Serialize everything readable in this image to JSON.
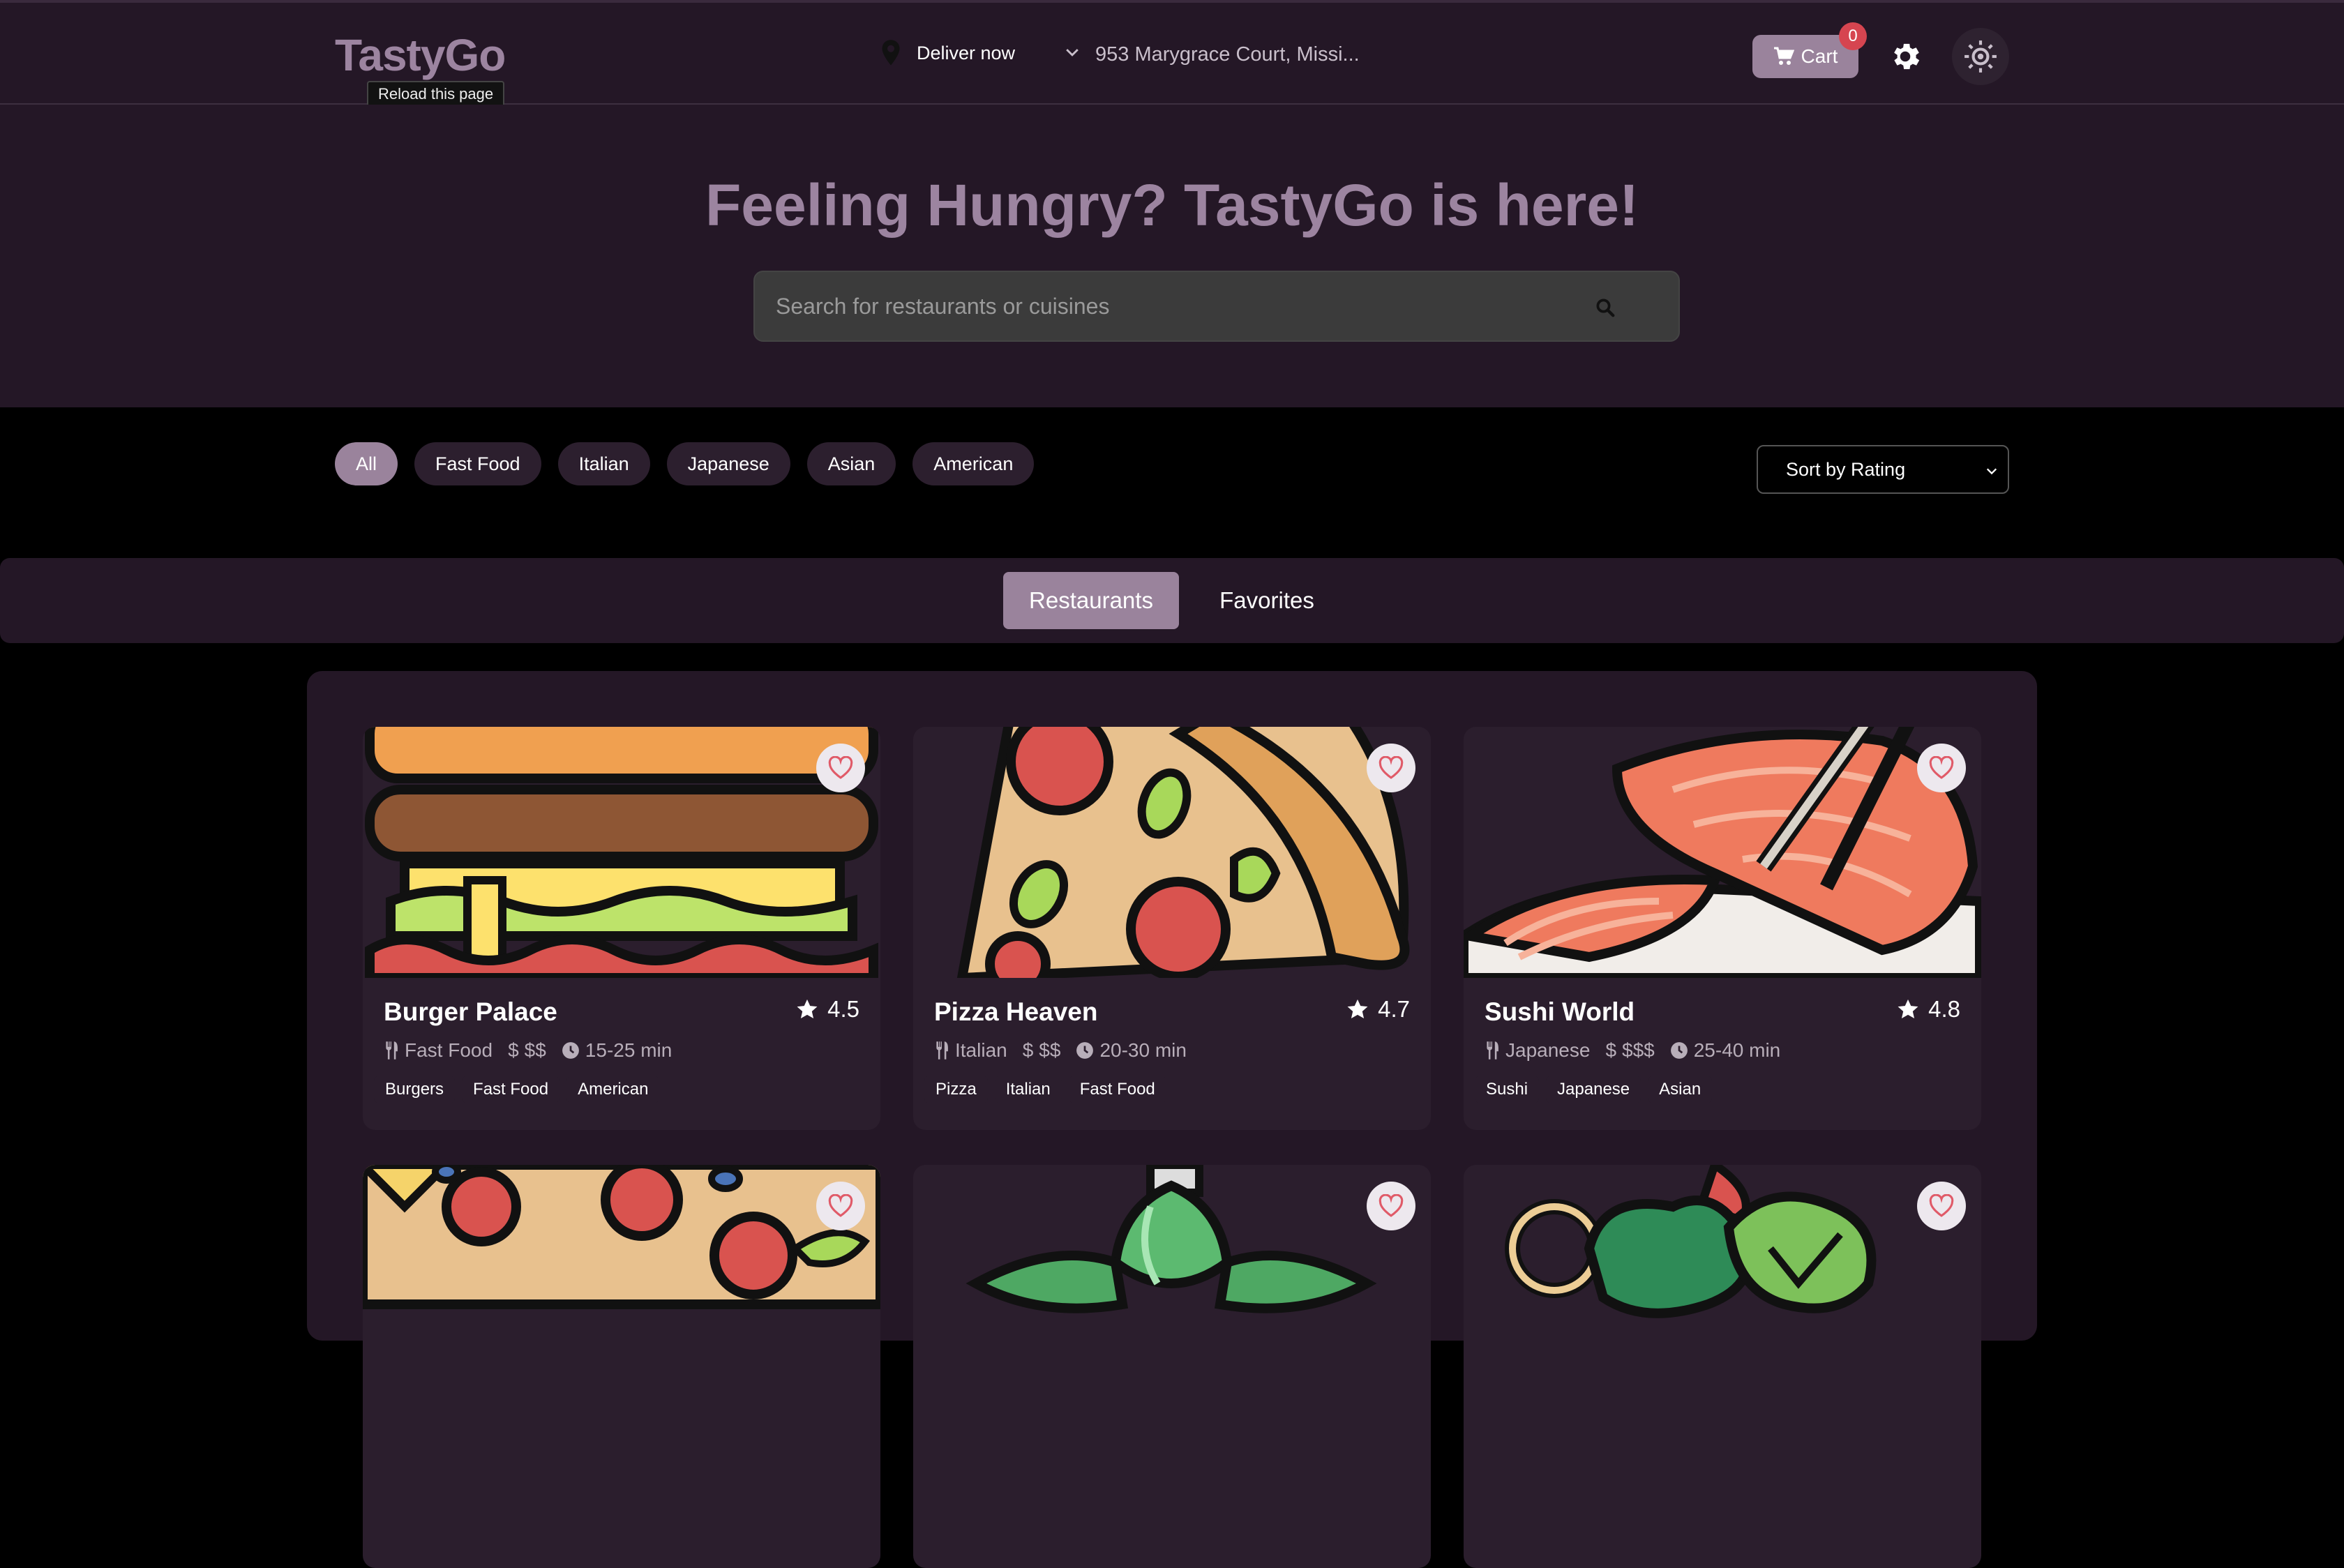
{
  "header": {
    "logo": "TastyGo",
    "tooltip": "Reload this page",
    "deliver_label": "Deliver now",
    "address": "953 Marygrace Court, Missi...",
    "cart_label": "Cart",
    "cart_count": "0",
    "icons": [
      "map-pin-icon",
      "chevron-down-icon",
      "cart-icon",
      "gear-icon",
      "sun-icon"
    ]
  },
  "hero": {
    "title": "Feeling Hungry? TastyGo is here!",
    "search_placeholder": "Search for restaurants or cuisines"
  },
  "filters": {
    "chips": [
      {
        "label": "All",
        "active": true
      },
      {
        "label": "Fast Food",
        "active": false
      },
      {
        "label": "Italian",
        "active": false
      },
      {
        "label": "Japanese",
        "active": false
      },
      {
        "label": "Asian",
        "active": false
      },
      {
        "label": "American",
        "active": false
      }
    ],
    "sort_selected": "Sort by Rating"
  },
  "tabs": {
    "restaurants": "Restaurants",
    "favorites": "Favorites",
    "active": "Restaurants"
  },
  "restaurants": [
    {
      "name": "Burger Palace",
      "rating": "4.5",
      "cuisine": "Fast Food",
      "price": "$$",
      "time": "15-25 min",
      "tags": [
        "Burgers",
        "Fast Food",
        "American"
      ],
      "image": "burger"
    },
    {
      "name": "Pizza Heaven",
      "rating": "4.7",
      "cuisine": "Italian",
      "price": "$$",
      "time": "20-30 min",
      "tags": [
        "Pizza",
        "Italian",
        "Fast Food"
      ],
      "image": "pizza"
    },
    {
      "name": "Sushi World",
      "rating": "4.8",
      "cuisine": "Japanese",
      "price": "$$$",
      "time": "25-40 min",
      "tags": [
        "Sushi",
        "Japanese",
        "Asian"
      ],
      "image": "sushi"
    }
  ],
  "colors": {
    "header_bg": "#241726",
    "accent": "#9a839c",
    "badge": "#d64550"
  }
}
